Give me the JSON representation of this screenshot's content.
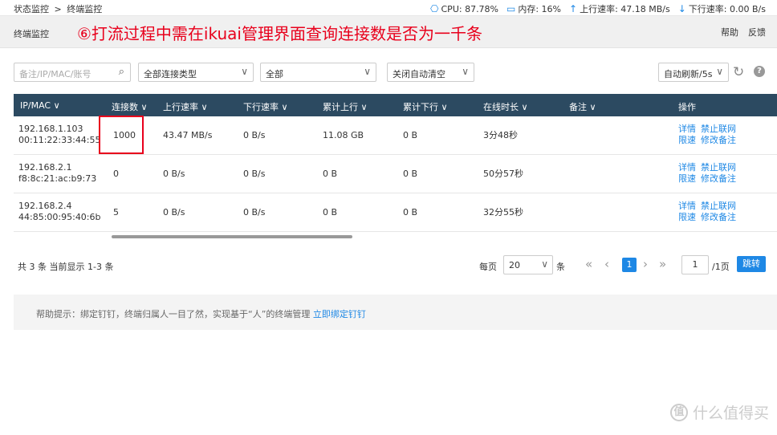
{
  "topbar": {
    "breadcrumb": [
      "状态监控",
      ">",
      "终端监控"
    ],
    "stats": [
      {
        "icon": "cpu-icon",
        "glyph": "⎔",
        "text": "CPU: 87.78%"
      },
      {
        "icon": "memory-icon",
        "glyph": "▭",
        "text": "内存: 16%"
      },
      {
        "icon": "upload-arrow-icon",
        "glyph": "↑",
        "text": "上行速率: 47.18 MB/s"
      },
      {
        "icon": "download-arrow-icon",
        "glyph": "↓",
        "text": "下行速率: 0.00 B/s"
      }
    ]
  },
  "subheader": {
    "title": "终端监控",
    "annotation": "⑥打流过程中需在ikuai管理界面查询连接数是否为一千条",
    "links": [
      "帮助",
      "反馈"
    ]
  },
  "filters": {
    "search_placeholder": "备注/IP/MAC/账号",
    "conn_type": "全部连接类型",
    "all": "全部",
    "auto_clear": "关闭自动清空",
    "auto_refresh": "自动刷新/5s"
  },
  "table": {
    "headers": [
      "IP/MAC ∨",
      "连接数 ∨",
      "上行速率 ∨",
      "下行速率 ∨",
      "累计上行 ∨",
      "累计下行 ∨",
      "在线时长 ∨",
      "备注 ∨",
      "操作"
    ],
    "rows": [
      {
        "ip": "192.168.1.103",
        "mac": "00:11:22:33:44:55",
        "conn": "1000",
        "up": "43.47 MB/s",
        "down": "0 B/s",
        "total_up": "11.08 GB",
        "total_down": "0 B",
        "online": "3分48秒",
        "note": "",
        "act1": "详情",
        "act2": "禁止联网",
        "act3": "限速",
        "act4": "修改备注"
      },
      {
        "ip": "192.168.2.1",
        "mac": "f8:8c:21:ac:b9:73",
        "conn": "0",
        "up": "0 B/s",
        "down": "0 B/s",
        "total_up": "0 B",
        "total_down": "0 B",
        "online": "50分57秒",
        "note": "",
        "act1": "详情",
        "act2": "禁止联网",
        "act3": "限速",
        "act4": "修改备注"
      },
      {
        "ip": "192.168.2.4",
        "mac": "44:85:00:95:40:6b",
        "conn": "5",
        "up": "0 B/s",
        "down": "0 B/s",
        "total_up": "0 B",
        "total_down": "0 B",
        "online": "32分55秒",
        "note": "",
        "act1": "详情",
        "act2": "禁止联网",
        "act3": "限速",
        "act4": "修改备注"
      }
    ]
  },
  "pager": {
    "total": "共 3 条 当前显示 1-3 条",
    "per_page_label": "每页",
    "per_page": "20",
    "unit": "条",
    "current_page": "1",
    "jump_value": "1",
    "pages": "/1页",
    "jump_label": "跳转"
  },
  "tip": {
    "text": "帮助提示：绑定钉钉，终端归属人一目了然，实现基于“人”的终端管理",
    "link": "立即绑定钉钉"
  },
  "watermark": {
    "logo": "值",
    "text": "什么值得买"
  },
  "colors": {
    "header_bg": "#2c4a61",
    "accent": "#1e88e5",
    "annotation": "#e8001c"
  }
}
